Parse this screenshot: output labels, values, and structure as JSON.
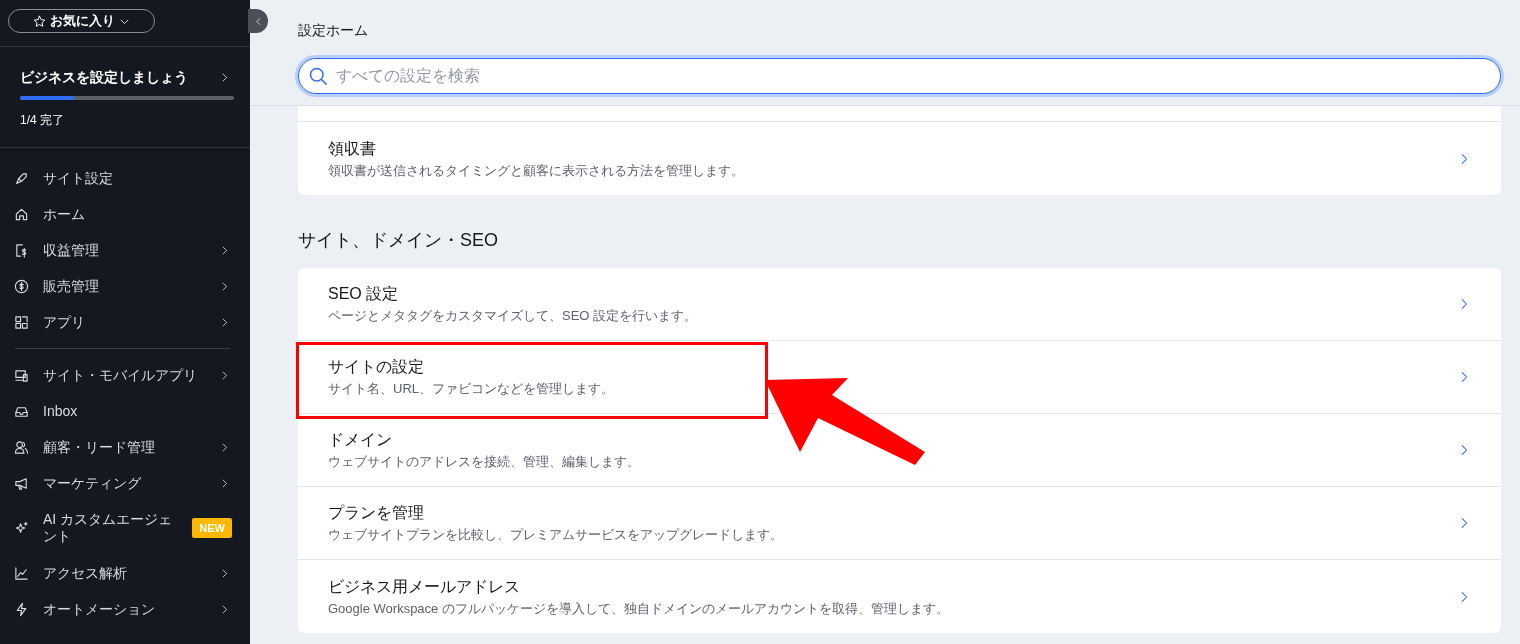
{
  "sidebar": {
    "favorites": {
      "label": "お気に入り"
    },
    "setup": {
      "title": "ビジネスを設定しましょう",
      "level": 0.25,
      "progress_text": "1/4 完了"
    },
    "groups": [
      [
        {
          "label": "サイト設定",
          "has_submenu": false
        },
        {
          "label": "ホーム",
          "has_submenu": false
        },
        {
          "label": "収益管理",
          "has_submenu": true
        },
        {
          "label": "販売管理",
          "has_submenu": true
        },
        {
          "label": "アプリ",
          "has_submenu": true
        }
      ],
      [
        {
          "label": "サイト・モバイルアプリ",
          "has_submenu": true
        },
        {
          "label": "Inbox",
          "has_submenu": false
        },
        {
          "label": "顧客・リード管理",
          "has_submenu": true
        },
        {
          "label": "マーケティング",
          "has_submenu": true
        },
        {
          "label": "AI カスタムエージェント",
          "has_submenu": false,
          "badge": "NEW"
        },
        {
          "label": "アクセス解析",
          "has_submenu": true
        },
        {
          "label": "オートメーション",
          "has_submenu": true
        }
      ]
    ]
  },
  "header": {
    "title": "設定ホーム",
    "search": {
      "placeholder": "すべての設定を検索"
    }
  },
  "sections": [
    {
      "rows": [
        {
          "title": "領収書",
          "description": "領収書が送信されるタイミングと顧客に表示される方法を管理します。",
          "highlighted": false
        }
      ]
    },
    {
      "heading": "サイト、ドメイン・SEO",
      "rows": [
        {
          "title": "SEO 設定",
          "description": "ページとメタタグをカスタマイズして、SEO 設定を行います。",
          "highlighted": false
        },
        {
          "title": "サイトの設定",
          "description": "サイト名、URL、ファビコンなどを管理します。",
          "highlighted": true
        },
        {
          "title": "ドメイン",
          "description": "ウェブサイトのアドレスを接続、管理、編集します。",
          "highlighted": false
        },
        {
          "title": "プランを管理",
          "description": "ウェブサイトプランを比較し、プレミアムサービスをアップグレードします。",
          "highlighted": false
        },
        {
          "title": "ビジネス用メールアドレス",
          "description": "Google Workspace のフルパッケージを導入して、独自ドメインのメールアカウントを取得、管理します。",
          "highlighted": false
        }
      ]
    }
  ]
}
